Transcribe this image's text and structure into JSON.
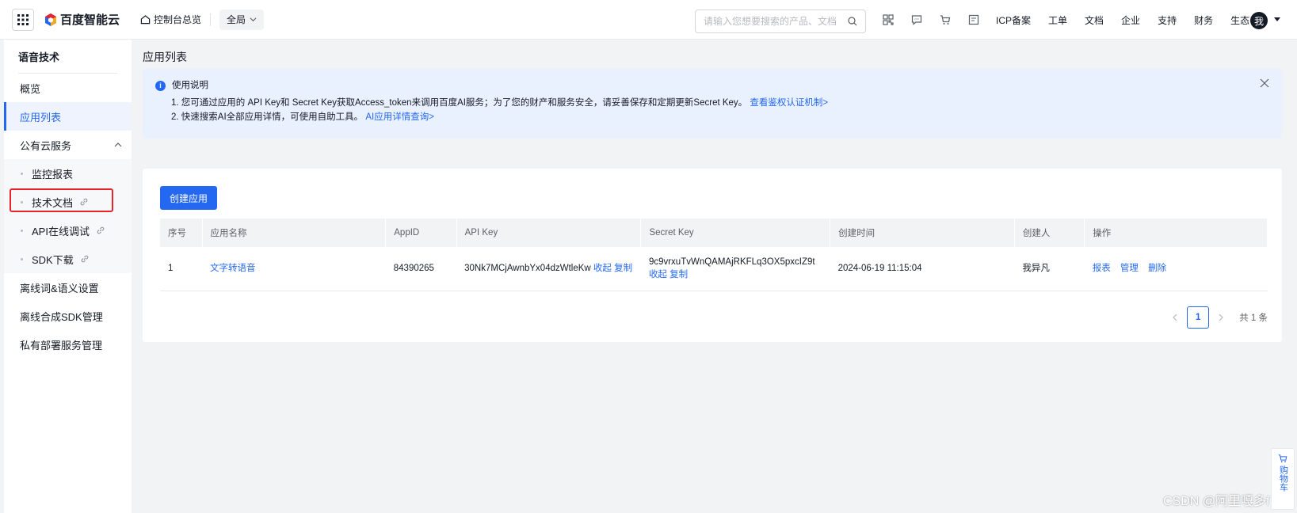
{
  "topbar": {
    "brand": "百度智能云",
    "home_link": "控制台总览",
    "region": "全局",
    "search_placeholder": "请输入您想要搜索的产品、文档",
    "nav": [
      "ICP备案",
      "工单",
      "文档",
      "企业",
      "支持",
      "财务",
      "生态"
    ],
    "avatar": "我"
  },
  "sidebar": {
    "title": "语音技术",
    "items": {
      "overview": "概览",
      "app_list": "应用列表",
      "public_cloud": "公有云服务",
      "monitor": "监控报表",
      "tech_docs": "技术文档",
      "api_debug": "API在线调试",
      "sdk_download": "SDK下载",
      "offline_words": "离线词&语义设置",
      "offline_sdk": "离线合成SDK管理",
      "private_deploy": "私有部署服务管理"
    }
  },
  "main": {
    "page_title": "应用列表",
    "notice": {
      "heading": "使用说明",
      "line1": "1. 您可通过应用的 API Key和 Secret Key获取Access_token来调用百度AI服务；为了您的财产和服务安全，请妥善保存和定期更新Secret Key。",
      "line1_link": "查看鉴权认证机制>",
      "line2": "2. 快速搜索AI全部应用详情，可使用自助工具。",
      "line2_link": "AI应用详情查询>"
    },
    "create_button": "创建应用",
    "table": {
      "headers": [
        "序号",
        "应用名称",
        "AppID",
        "API Key",
        "Secret Key",
        "创建时间",
        "创建人",
        "操作"
      ],
      "row": {
        "index": "1",
        "name": "文字转语音",
        "app_id": "84390265",
        "api_key": "30Nk7MCjAwnbYx04dzWtleKw",
        "collapse": "收起",
        "copy": "复制",
        "secret_key": "9c9vrxuTvWnQAMAjRKFLq3OX5pxcIZ9t",
        "created": "2024-06-19 11:15:04",
        "creator": "我异凡",
        "ops": [
          "报表",
          "管理",
          "删除"
        ]
      }
    },
    "pager": {
      "current": "1",
      "total": "共 1 条"
    }
  },
  "cart_float": "购物车",
  "watermark": "CSDN @阿里嘎多f",
  "colors": {
    "accent": "#2468f2",
    "highlight": "#e8242a",
    "notice_bg": "#e9f1fe"
  }
}
